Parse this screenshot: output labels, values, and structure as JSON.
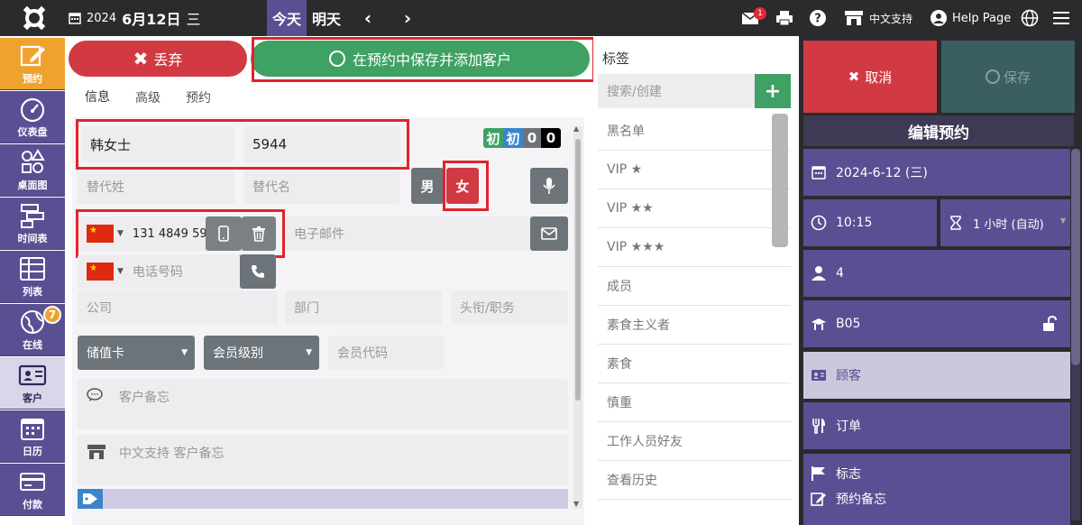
{
  "topbar": {
    "year": "2024",
    "date": "6月12日",
    "weekday": "三",
    "today_label": "今天",
    "tomorrow_label": "明天",
    "mail_count": "1",
    "support_label": "中文支持",
    "help_label": "Help Page"
  },
  "sidebar": {
    "items": [
      {
        "label": "预约"
      },
      {
        "label": "仪表盘"
      },
      {
        "label": "桌面图"
      },
      {
        "label": "时间表"
      },
      {
        "label": "列表"
      },
      {
        "label": "在线",
        "badge": "7"
      },
      {
        "label": "客户"
      },
      {
        "label": "日历"
      },
      {
        "label": "付款"
      }
    ]
  },
  "form": {
    "discard_label": "丢弃",
    "save_add_label": "在预约中保存并添加客户",
    "tabs": [
      "信息",
      "高级",
      "预约"
    ],
    "last_name": "韩女士",
    "first_name": "5944",
    "alt_last_placeholder": "替代姓",
    "alt_first_placeholder": "替代名",
    "male_label": "男",
    "female_label": "女",
    "chips": [
      "初",
      "初",
      "0",
      "0"
    ],
    "phone_value": "131 4849 59",
    "email_placeholder": "电子邮件",
    "phone2_placeholder": "电话号码",
    "company_placeholder": "公司",
    "department_placeholder": "部门",
    "title_placeholder": "头衔/职务",
    "card_label": "储值卡",
    "member_level_label": "会员级别",
    "member_code_placeholder": "会员代码",
    "note_placeholder": "客户备忘",
    "support_note_placeholder": "中文支持 客户备忘"
  },
  "tags": {
    "title": "标签",
    "search_placeholder": "搜索/创建",
    "items": [
      "黑名单",
      "VIP ★",
      "VIP ★★",
      "VIP ★★★",
      "成员",
      "素食主义者",
      "素食",
      "慎重",
      "工作人员好友",
      "查看历史"
    ]
  },
  "right": {
    "cancel_label": "取消",
    "save_label": "保存",
    "title": "编辑预约",
    "date": "2024-6-12 (三)",
    "time": "10:15",
    "duration": "1 小时 (自动)",
    "guests": "4",
    "table": "B05",
    "customer": "顾客",
    "order": "订单",
    "flag": "标志",
    "note": "预约备忘"
  }
}
